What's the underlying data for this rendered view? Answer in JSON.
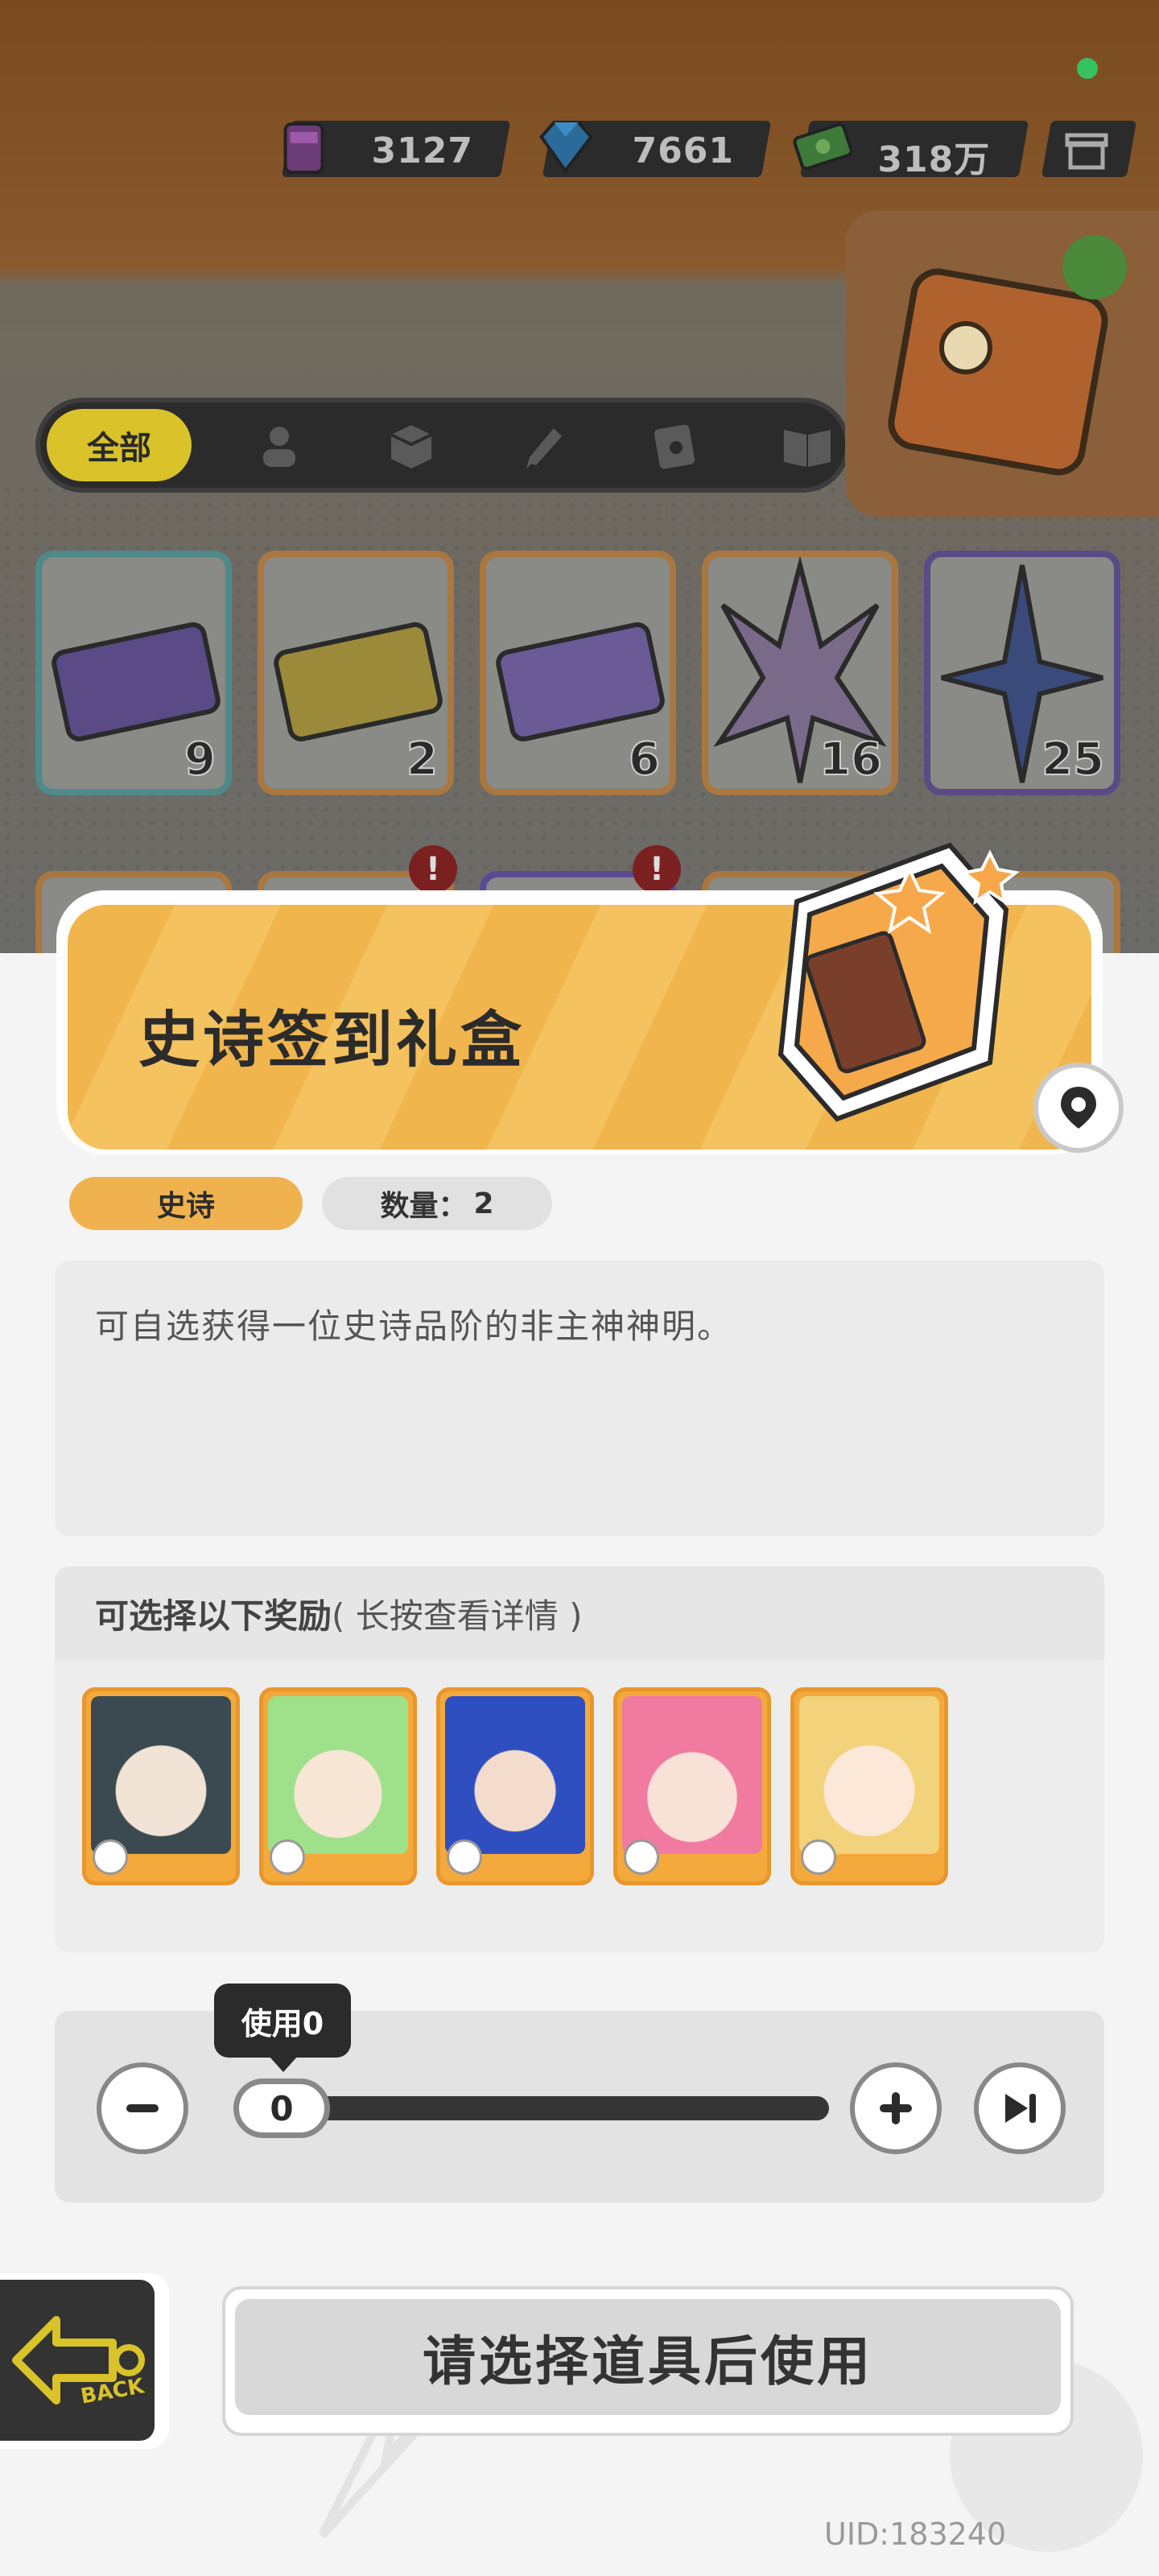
{
  "currencies": [
    {
      "icon": "potion-can-icon",
      "value": "3127"
    },
    {
      "icon": "diamond-icon",
      "value": "7661"
    },
    {
      "icon": "cash-icon",
      "value": "318万"
    }
  ],
  "filter": {
    "all_label": "全部",
    "tabs": [
      "person-icon",
      "box-icon",
      "pen-icon",
      "card-icon",
      "book-icon"
    ]
  },
  "inventory": [
    {
      "name": "purple-ticket",
      "count": "9"
    },
    {
      "name": "gold-ticket",
      "count": "2"
    },
    {
      "name": "violet-ticket",
      "count": "6"
    },
    {
      "name": "rainbow-star",
      "count": "16"
    },
    {
      "name": "blue-star",
      "count": "25"
    }
  ],
  "badges": [
    "!",
    "!"
  ],
  "item": {
    "title": "史诗签到礼盒",
    "rarity": "史诗",
    "quantity_label": "数量：",
    "quantity": "2",
    "description": "可自选获得一位史诗品阶的非主神神明。"
  },
  "rewards": {
    "header": "可选择以下奖励",
    "hint": "( 长按查看详情 )",
    "heroes": [
      {
        "name": "hero-dark-hair",
        "color": "#3a4a50"
      },
      {
        "name": "hero-green-hair",
        "color": "#9fe08a"
      },
      {
        "name": "hero-blue-hair",
        "color": "#2f4fc0"
      },
      {
        "name": "hero-pink-cap",
        "color": "#f07aa0"
      },
      {
        "name": "hero-blonde",
        "color": "#f2d27a"
      }
    ]
  },
  "slider": {
    "tooltip": "使用0",
    "value": "0",
    "level": 0
  },
  "actions": {
    "use_label": "请选择道具后使用",
    "back_label": "BACK"
  },
  "uid": "UID:183240",
  "colors": {
    "accent_orange": "#f0b54d",
    "rarity_tag": "#efb24f",
    "dark": "#2b2b2b",
    "yellow": "#d9c22a"
  }
}
